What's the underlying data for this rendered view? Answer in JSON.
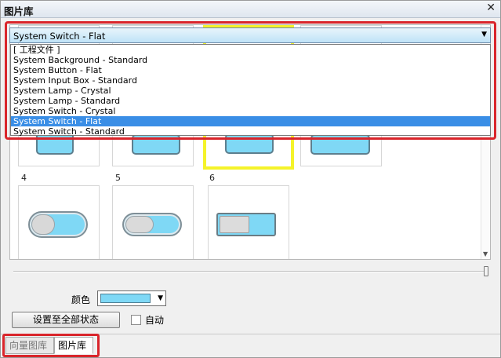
{
  "window": {
    "title": "图片库",
    "close_glyph": "✕"
  },
  "library": {
    "selected": "System Switch - Flat",
    "options": [
      "[ 工程文件 ]",
      "System Background - Standard",
      "System Button - Flat",
      "System Input Box - Standard",
      "System Lamp - Crystal",
      "System Lamp - Standard",
      "System Switch - Crystal",
      "System Switch - Flat",
      "System Switch - Standard"
    ],
    "selected_index": 7
  },
  "gallery": {
    "items": [
      {
        "label": "4"
      },
      {
        "label": "5"
      },
      {
        "label": "6"
      }
    ],
    "selected_color": "#f5f32a"
  },
  "color": {
    "label": "颜色",
    "value": "#7fd8f5"
  },
  "apply_button": "设置至全部状态",
  "auto": {
    "label": "自动",
    "checked": false
  },
  "tabs": [
    {
      "label": "向量图库",
      "active": false
    },
    {
      "label": "图片库",
      "active": true
    }
  ],
  "highlight_color": "#d9252b"
}
